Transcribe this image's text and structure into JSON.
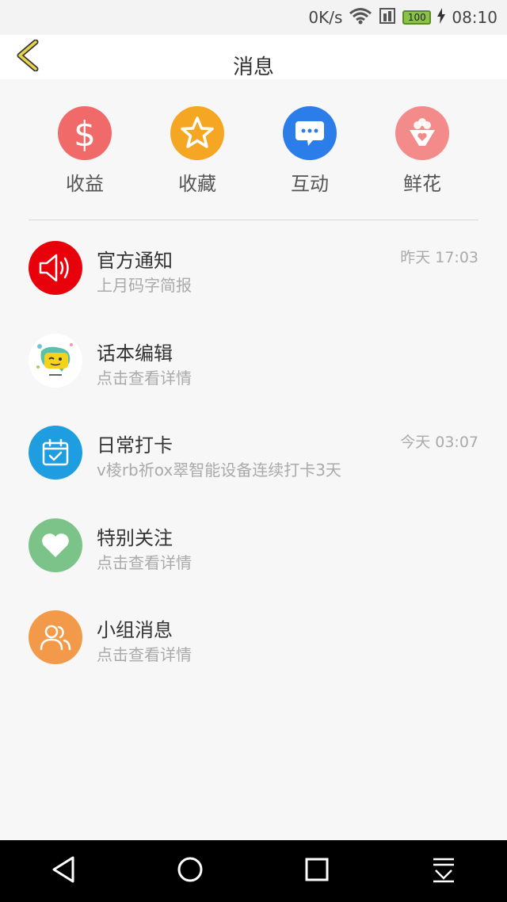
{
  "status": {
    "speed": "0K/s",
    "battery": "100",
    "time": "08:10"
  },
  "header": {
    "title": "消息"
  },
  "quick_actions": [
    {
      "label": "收益",
      "icon": "dollar-icon",
      "color": "#f06a6a"
    },
    {
      "label": "收藏",
      "icon": "star-icon",
      "color": "#f5a623"
    },
    {
      "label": "互动",
      "icon": "chat-bubble-icon",
      "color": "#2b7de9"
    },
    {
      "label": "鲜花",
      "icon": "flower-bouquet-icon",
      "color": "#f38b8b"
    }
  ],
  "messages": [
    {
      "title": "官方通知",
      "subtitle": "上月码字简报",
      "time": "昨天 17:03",
      "icon": "speaker-icon",
      "color": "#e8000b"
    },
    {
      "title": "话本编辑",
      "subtitle": "点击查看详情",
      "time": "",
      "icon": "editor-avatar-icon",
      "color": "#ffffff"
    },
    {
      "title": "日常打卡",
      "subtitle": "v棱rb祈ox翠智能设备连续打卡3天",
      "time": "今天 03:07",
      "icon": "calendar-check-icon",
      "color": "#1e9ee0"
    },
    {
      "title": "特别关注",
      "subtitle": "点击查看详情",
      "time": "",
      "icon": "heart-icon",
      "color": "#7cc38a"
    },
    {
      "title": "小组消息",
      "subtitle": "点击查看详情",
      "time": "",
      "icon": "group-icon",
      "color": "#f39a4a"
    }
  ]
}
